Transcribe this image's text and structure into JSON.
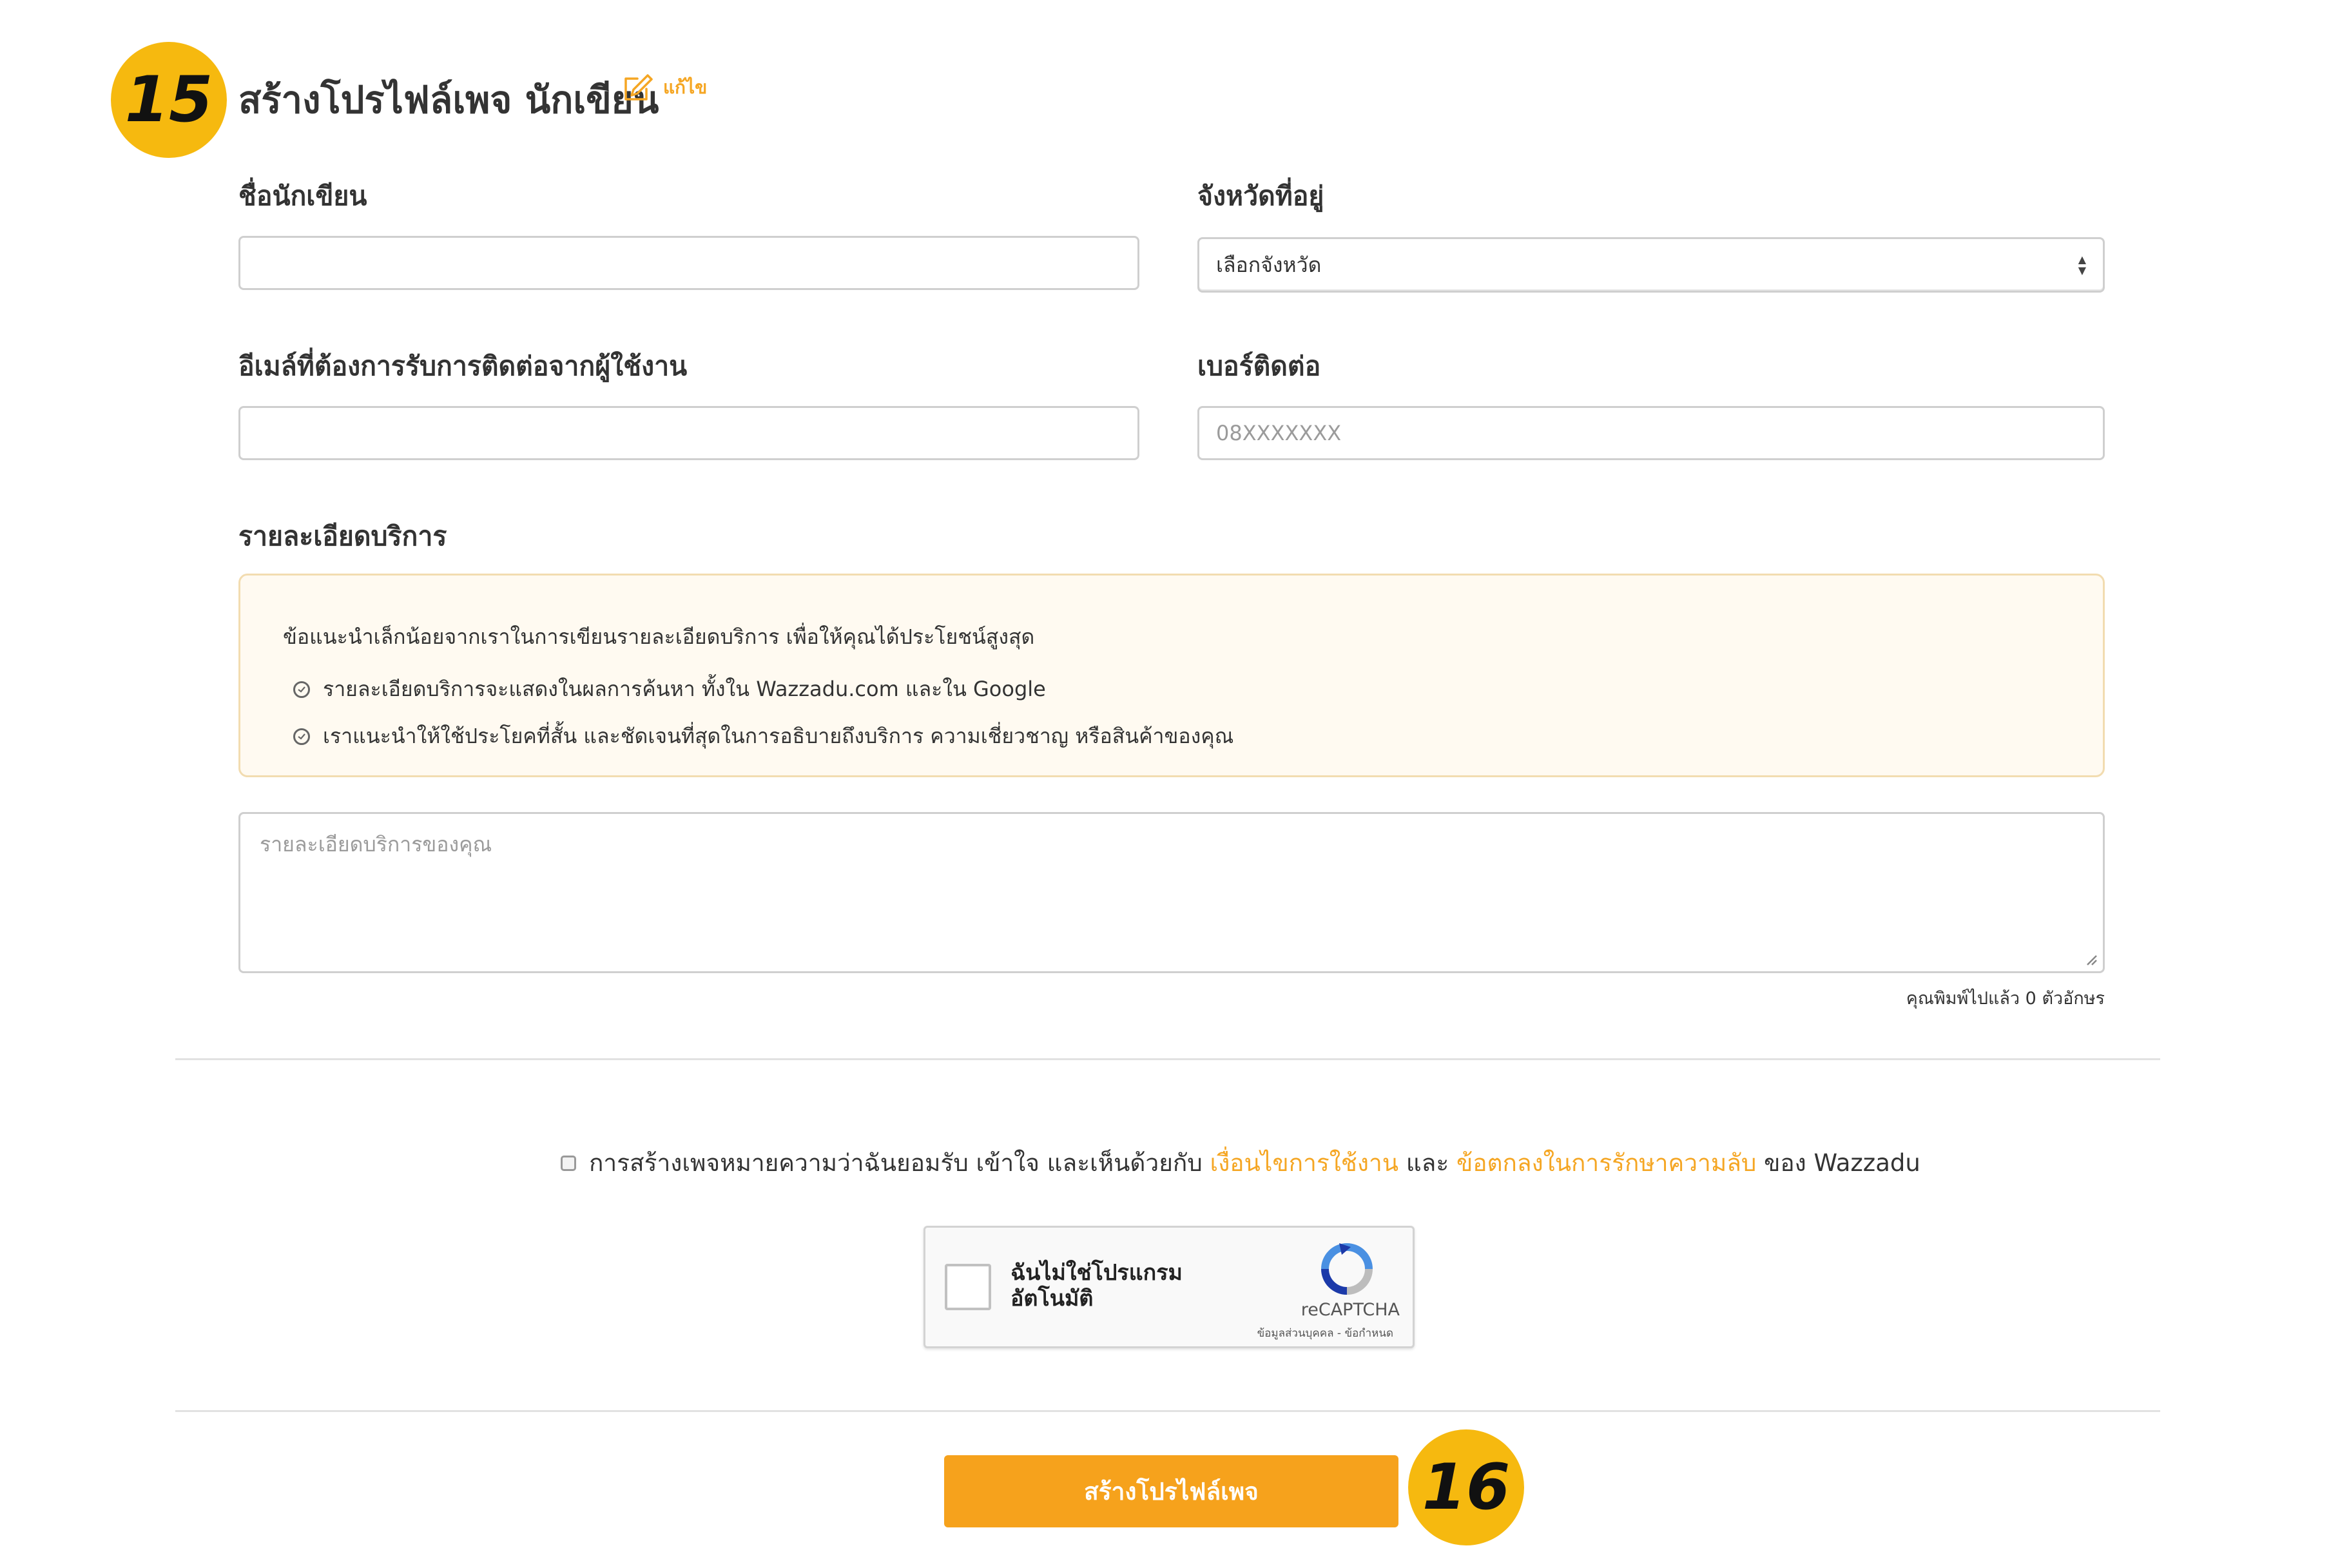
{
  "steps": {
    "first": "15",
    "second": "16"
  },
  "header": {
    "title": "สร้างโปรไฟล์เพจ นักเขียน",
    "edit_label": "แก้ไข"
  },
  "form": {
    "name": {
      "label": "ชื่อนักเขียน",
      "value": ""
    },
    "province": {
      "label": "จังหวัดที่อยู่",
      "selected": "เลือกจังหวัด"
    },
    "email": {
      "label": "อีเมล์ที่ต้องการรับการติดต่อจากผู้ใช้งาน",
      "value": ""
    },
    "phone": {
      "label": "เบอร์ติดต่อ",
      "placeholder": "08XXXXXXX"
    },
    "details": {
      "label": "รายละเอียดบริการ",
      "tips_intro": "ข้อแนะนำเล็กน้อยจากเราในการเขียนรายละเอียดบริการ เพื่อให้คุณได้ประโยชน์สูงสุด",
      "tips": [
        "รายละเอียดบริการจะแสดงในผลการค้นหา ทั้งใน Wazzadu.com และใน Google",
        "เราแนะนำให้ใช้ประโยคที่สั้น และชัดเจนที่สุดในการอธิบายถึงบริการ ความเชี่ยวชาญ หรือสินค้าของคุณ"
      ],
      "placeholder": "รายละเอียดบริการของคุณ",
      "counter": "คุณพิมพ์ไปแล้ว 0 ตัวอักษร"
    }
  },
  "terms": {
    "prefix": "การสร้างเพจหมายความว่าฉันยอมรับ เข้าใจ และเห็นด้วยกับ",
    "terms_link": "เงื่อนไขการใช้งาน",
    "and": "และ",
    "privacy_link": "ข้อตกลงในการรักษาความลับ",
    "suffix": "ของ Wazzadu"
  },
  "recaptcha": {
    "line1": "ฉันไม่ใช่โปรแกรม",
    "line2": "อัตโนมัติ",
    "brand": "reCAPTCHA",
    "links": "ข้อมูลส่วนบุคคล - ข้อกำหนด"
  },
  "submit_label": "สร้างโปรไฟล์เพจ",
  "colors": {
    "accent": "#f5a623",
    "badge": "#f6b90f",
    "tips_bg": "#fffaf1"
  },
  "icons": {
    "edit": "pencil-square-icon",
    "tip": "check-circle-icon",
    "select": "sort-arrows-icon"
  }
}
